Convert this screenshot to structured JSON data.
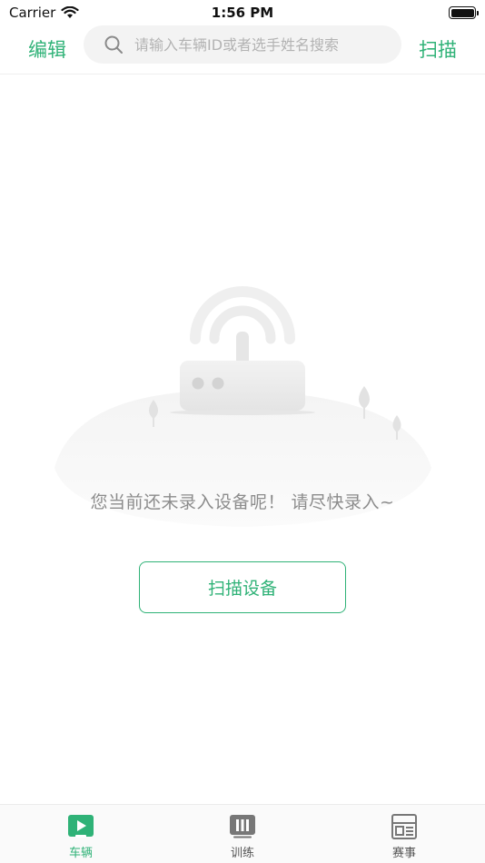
{
  "status_bar": {
    "carrier": "Carrier",
    "time": "1:56 PM"
  },
  "nav": {
    "edit_label": "编辑",
    "scan_label": "扫描",
    "search_placeholder": "请输入车辆ID或者选手姓名搜索"
  },
  "empty_state": {
    "message": "您当前还未录入设备呢！ 请尽快录入~",
    "button_label": "扫描设备"
  },
  "tabs": [
    {
      "label": "车辆",
      "icon": "vehicle-icon",
      "active": true
    },
    {
      "label": "训练",
      "icon": "training-icon",
      "active": false
    },
    {
      "label": "赛事",
      "icon": "event-icon",
      "active": false
    }
  ],
  "colors": {
    "accent": "#2fb277",
    "muted_text": "#8c8c8c",
    "placeholder": "#b3b3b3"
  }
}
